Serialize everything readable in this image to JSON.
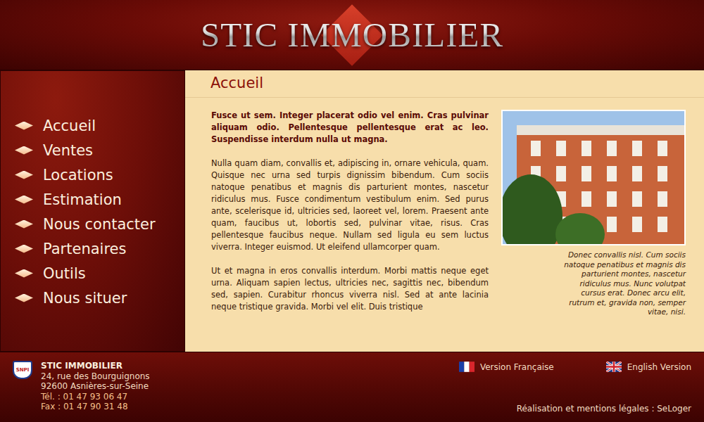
{
  "header": {
    "title": "STIC IMMOBILIER"
  },
  "nav": [
    {
      "label": "Accueil"
    },
    {
      "label": "Ventes"
    },
    {
      "label": "Locations"
    },
    {
      "label": "Estimation"
    },
    {
      "label": "Nous contacter"
    },
    {
      "label": "Partenaires"
    },
    {
      "label": "Outils"
    },
    {
      "label": "Nous situer"
    }
  ],
  "page": {
    "title": "Accueil",
    "lead": "Fusce ut sem. Integer placerat odio vel enim. Cras pulvinar aliquam odio. Pellentesque pellentesque erat ac leo. Suspendisse interdum nulla ut magna.",
    "paragraphs": [
      "Nulla quam diam, convallis et, adipiscing in, ornare vehicula, quam. Quisque nec urna sed turpis dignissim bibendum. Cum sociis natoque penatibus et magnis dis parturient montes, nascetur ridiculus mus. Fusce condimentum vestibulum enim. Sed purus ante, scelerisque id, ultricies sed, laoreet vel, lorem. Praesent ante quam, faucibus ut, lobortis sed, pulvinar vitae, risus. Cras pellentesque faucibus neque. Nullam sed ligula eu sem luctus viverra. Integer euismod. Ut eleifend ullamcorper quam.",
      "Ut et magna in eros convallis interdum. Morbi mattis neque eget urna. Aliquam sapien lectus, ultricies nec, sagittis nec, bibendum sed, sapien. Curabitur rhoncus viverra nisl. Sed at ante lacinia neque tristique gravida. Morbi vel elit. Duis tristique"
    ],
    "photo_caption": "Donec convallis nisl. Cum sociis natoque penatibus et magnis dis parturient montes, nascetur ridiculus mus. Nunc volutpat cursus erat. Donec arcu elit, rutrum et, gravida non, semper vitae, nisi."
  },
  "footer": {
    "badge": "SNPI",
    "company": "STIC IMMOBILIER",
    "address": [
      "24, rue des Bourguignons",
      "92600 Asnières-sur-Seine"
    ],
    "phones": [
      "Tél. : 01 47 93 06 47",
      "Fax : 01 47 90 31 48"
    ],
    "languages": [
      {
        "label": "Version Française",
        "flag": "fr"
      },
      {
        "label": "English Version",
        "flag": "uk"
      }
    ],
    "credits": "Réalisation et mentions légales : SeLoger"
  }
}
